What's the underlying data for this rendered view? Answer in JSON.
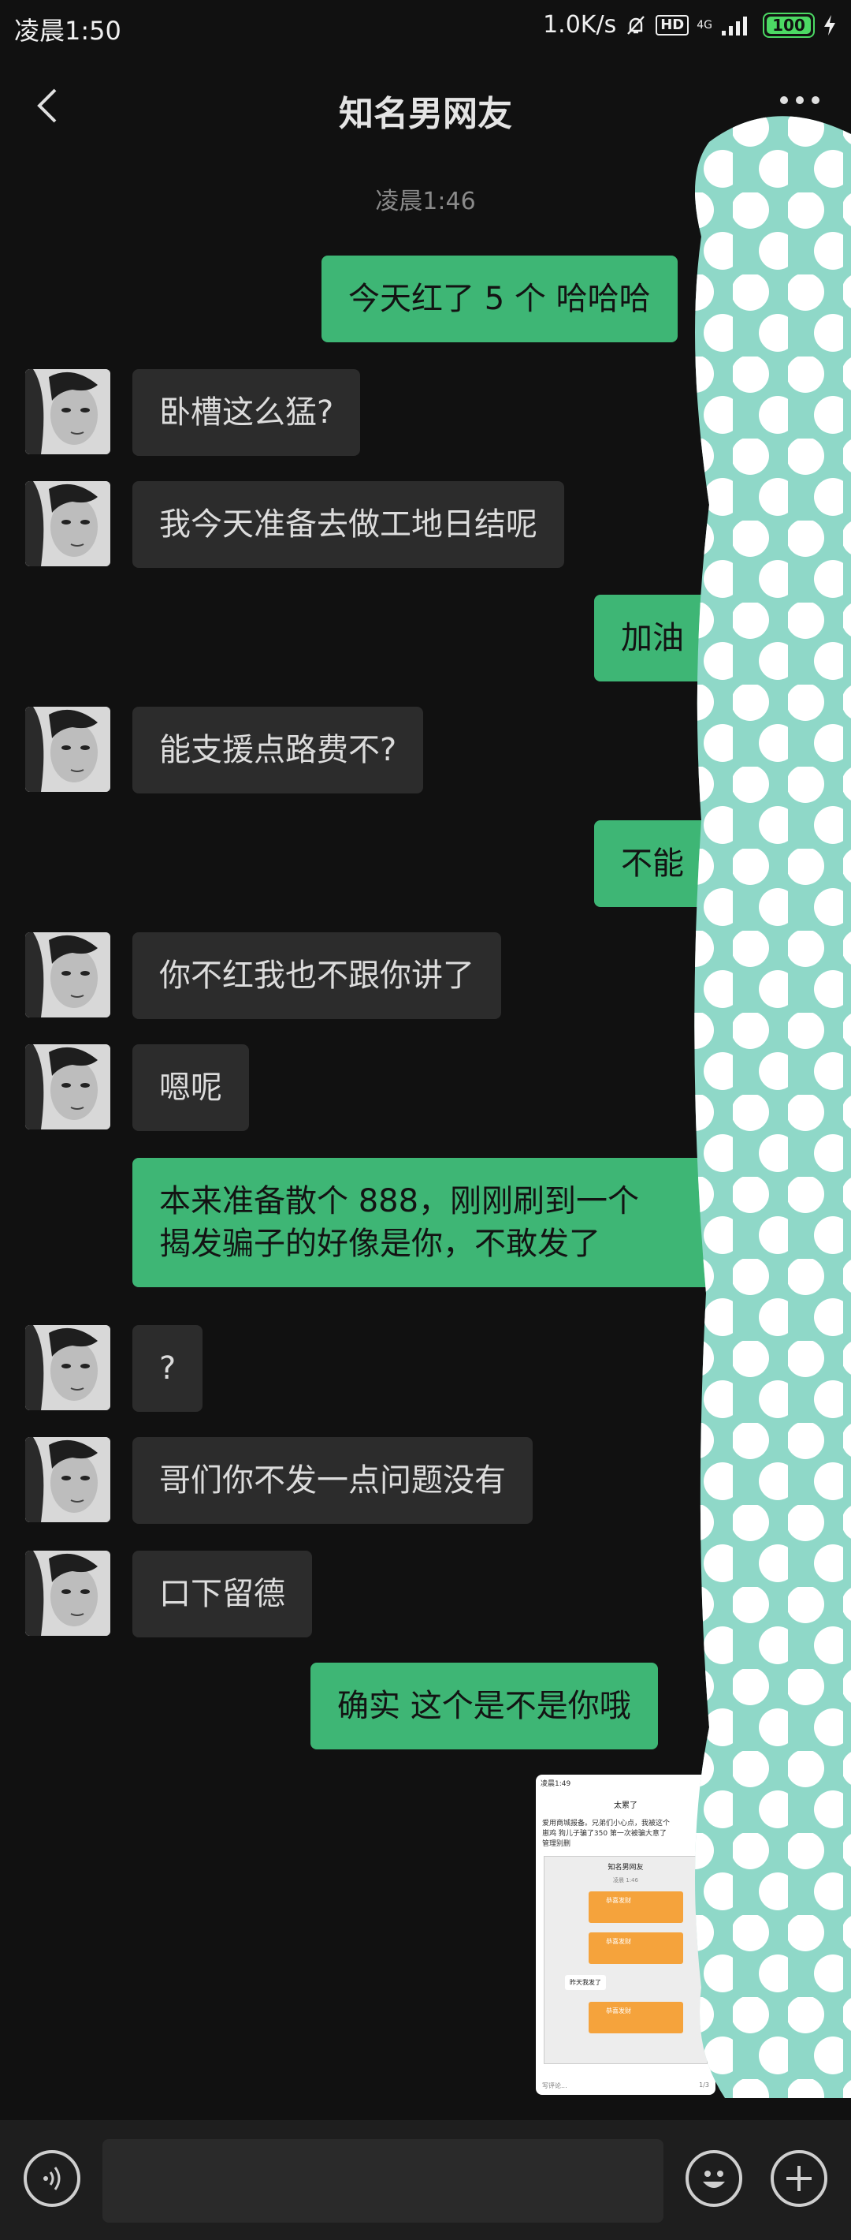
{
  "status": {
    "time": "凌晨1:50",
    "speed": "1.0K/s",
    "hd": "HD",
    "net_type": "4G",
    "battery": "100"
  },
  "nav": {
    "title": "知名男网友",
    "back_icon": "chevron-left-icon",
    "more_icon": "more-dots-icon"
  },
  "timestamp": "凌晨1:46",
  "messages": [
    {
      "side": "out",
      "text": "今天红了 5 个  哈哈哈"
    },
    {
      "side": "in",
      "text": "卧槽这么猛?"
    },
    {
      "side": "in",
      "text": "我今天准备去做工地日结呢"
    },
    {
      "side": "out",
      "text": "加油"
    },
    {
      "side": "in",
      "text": "能支援点路费不?"
    },
    {
      "side": "out",
      "text": "不能"
    },
    {
      "side": "in",
      "text": "你不红我也不跟你讲了"
    },
    {
      "side": "in",
      "text": "嗯呢"
    },
    {
      "side": "out",
      "text": "本来准备散个 888，刚刚刷到一个",
      "text2": "揭发骗子的好像是你，不敢发了"
    },
    {
      "side": "in",
      "text": "?"
    },
    {
      "side": "in",
      "text": "哥们你不发一点问题没有"
    },
    {
      "side": "in",
      "text": "口下留德"
    },
    {
      "side": "out",
      "text": "确实   这个是不是你哦"
    }
  ],
  "screenshot_thumb": {
    "status": "凌晨1:49",
    "author": "太累了",
    "post_line1": "爱用商城报备。兄弟们小心点，我被这个",
    "post_line2": "崽鸡 狗儿子骗了350 第一次被骗大意了",
    "post_line3": "管理别删",
    "inner_title": "知名男网友",
    "inner_time": "凌晨 1:46",
    "red_label": "恭喜发财",
    "inner_msg": "昨天我发了",
    "comment_placeholder": "写评论...",
    "page": "1/3"
  },
  "bottom": {
    "input_placeholder": "",
    "voice_icon": "voice-icon",
    "emoji_icon": "emoji-icon",
    "plus_icon": "plus-icon"
  },
  "colors": {
    "background": "#111111",
    "bubble_in": "#2c2c2c",
    "bubble_out": "#3eb675",
    "sticker": "#8fd8c8"
  }
}
